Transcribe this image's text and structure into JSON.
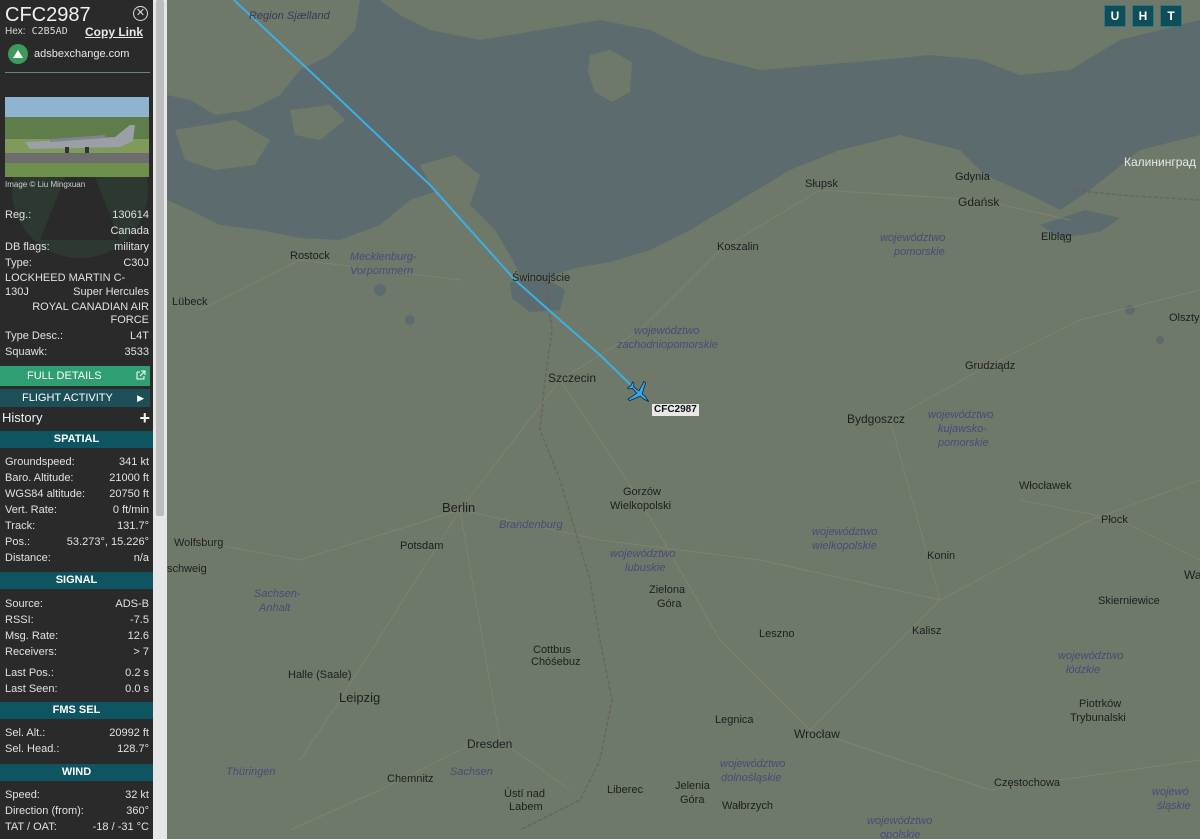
{
  "sidebar": {
    "callsign": "CFC2987",
    "hex_label": "Hex:",
    "hex": "C2B5AD",
    "copy_link": "Copy Link",
    "site": "adsbexchange.com",
    "image_credit": "Image © Liu Mingxuan",
    "reg_label": "Reg.:",
    "reg": "130614",
    "country": "Canada",
    "db_flags_label": "DB flags:",
    "db_flags": "military",
    "type_label": "Type:",
    "type": "C30J",
    "model_line1": "LOCKHEED MARTIN C-130J",
    "model_line2": "Super Hercules",
    "operator_line1": "ROYAL CANADIAN AIR",
    "operator_line2": "FORCE",
    "type_desc_label": "Type Desc.:",
    "type_desc": "L4T",
    "squawk_label": "Squawk:",
    "squawk": "3533",
    "full_details": "FULL DETAILS",
    "flight_activity": "FLIGHT ACTIVITY",
    "history": "History",
    "spatial": {
      "title": "SPATIAL",
      "rows": [
        {
          "k": "Groundspeed:",
          "v": "341 kt"
        },
        {
          "k": "Baro. Altitude:",
          "v": "21000 ft"
        },
        {
          "k": "WGS84 altitude:",
          "v": "20750 ft"
        },
        {
          "k": "Vert. Rate:",
          "v": "0 ft/min"
        },
        {
          "k": "Track:",
          "v": "131.7°"
        },
        {
          "k": "Pos.:",
          "v": "53.273°, 15.226°"
        },
        {
          "k": "Distance:",
          "v": "n/a"
        }
      ]
    },
    "signal": {
      "title": "SIGNAL",
      "rows": [
        {
          "k": "Source:",
          "v": "ADS-B"
        },
        {
          "k": "RSSI:",
          "v": "-7.5"
        },
        {
          "k": "Msg. Rate:",
          "v": "12.6"
        },
        {
          "k": "Receivers:",
          "v": "> 7"
        },
        {
          "k": "Last Pos.:",
          "v": "0.2 s"
        },
        {
          "k": "Last Seen:",
          "v": "0.0 s"
        }
      ]
    },
    "fms": {
      "title": "FMS SEL",
      "rows": [
        {
          "k": "Sel. Alt.:",
          "v": "20992 ft"
        },
        {
          "k": "Sel. Head.:",
          "v": "128.7°"
        }
      ]
    },
    "wind": {
      "title": "WIND",
      "rows": [
        {
          "k": "Speed:",
          "v": "32 kt"
        },
        {
          "k": "Direction (from):",
          "v": "360°"
        },
        {
          "k": "TAT / OAT:",
          "v": "-18 / -31 °C"
        }
      ]
    }
  },
  "map": {
    "buttons": [
      "U",
      "H",
      "T"
    ],
    "aircraft_label": "CFC2987",
    "track_color": "#3ab0e6",
    "aircraft_color": "#3aa8ea",
    "labels": {
      "region_sjaelland": "Region Sjælland",
      "kaliningrad": "Калининград",
      "slupsk": "Słupsk",
      "gdynia": "Gdynia",
      "gdansk": "Gdańsk",
      "elblag": "Elbląg",
      "koszalin": "Koszalin",
      "pomorskie1": "województwo",
      "pomorskie2": "pomorskie",
      "rostock": "Rostock",
      "mv1": "Mecklenburg-",
      "mv2": "Vorpommern",
      "swinoujscie": "Świnoujście",
      "lubeck": "Lübeck",
      "olsztyn": "Olsztyn",
      "zachodnio1": "województwo",
      "zachodnio2": "zachodniopomorskie",
      "grudziadz": "Grudziądz",
      "szczecin": "Szczecin",
      "bydgoszcz": "Bydgoszcz",
      "kujawsko1": "województwo",
      "kujawsko2": "kujawsko-",
      "kujawsko3": "pomorskie",
      "gorzow1": "Gorzów",
      "gorzow2": "Wielkopolski",
      "wloclawek": "Włocławek",
      "berlin": "Berlin",
      "brandenburg": "Brandenburg",
      "plock": "Płock",
      "wolfsburg": "Wolfsburg",
      "potsdam": "Potsdam",
      "wielkopolskie1": "województwo",
      "wielkopolskie2": "wielkopolskie",
      "schweig": "schweig",
      "lubuskie1": "województwo",
      "lubuskie2": "lubuskie",
      "konin": "Konin",
      "wa": "Wa",
      "sachsen_anhalt1": "Sachsen-",
      "sachsen_anhalt2": "Anhalt",
      "zielona1": "Zielona",
      "zielona2": "Góra",
      "skierniewice": "Skierniewice",
      "cottbus1": "Cottbus",
      "cottbus2": "Chóśebuz",
      "leszno": "Leszno",
      "kalisz": "Kalisz",
      "halle": "Halle (Saale)",
      "lodzkie1": "województwo",
      "lodzkie2": "łódzkie",
      "leipzig": "Leipzig",
      "piotrkow1": "Piotrków",
      "piotrkow2": "Trybunalski",
      "legnica": "Legnica",
      "dresden": "Dresden",
      "wroclaw": "Wrocław",
      "thuringen": "Thüringen",
      "sachsen": "Sachsen",
      "dolnoslaskie1": "województwo",
      "dolnoslaskie2": "dolnośląskie",
      "chemnitz": "Chemnitz",
      "usti1": "Ústí nad",
      "usti2": "Labem",
      "liberec": "Liberec",
      "jelenia1": "Jelenia",
      "jelenia2": "Góra",
      "walbrzych": "Wałbrzych",
      "czestochowa": "Częstochowa",
      "slaskie1": "wojewó",
      "slaskie2": "śląskie",
      "opolskie1": "województwo",
      "opolskie2": "opolskie"
    }
  }
}
